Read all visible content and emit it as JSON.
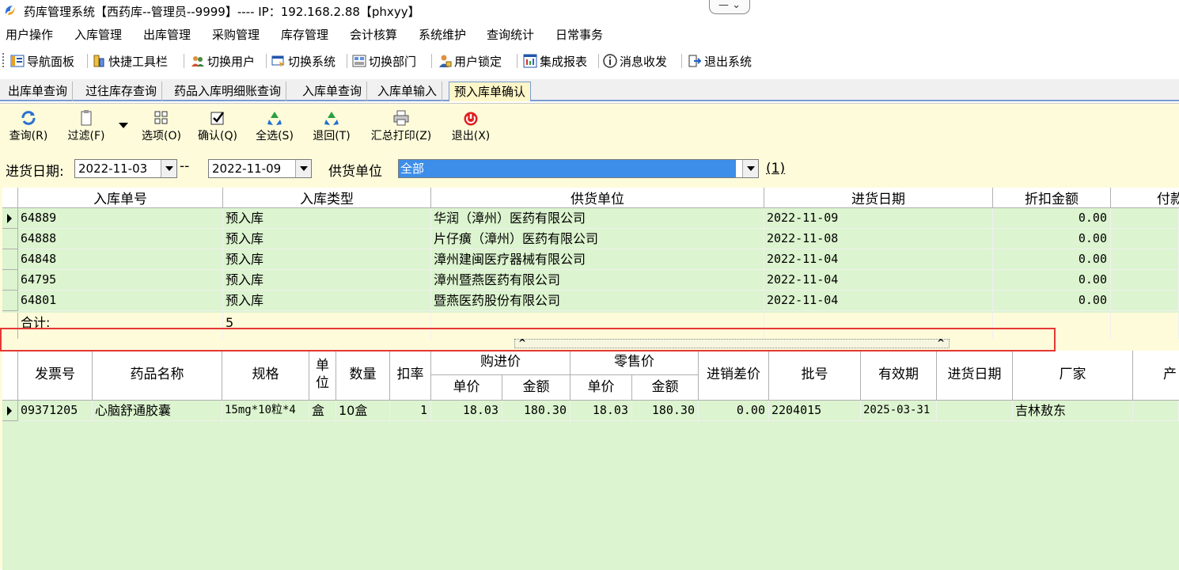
{
  "window": {
    "title": "药库管理系统【西药库--管理员--9999】---- IP：192.168.2.88【phxyy】",
    "controls": "—  ⌄"
  },
  "menu": [
    "用户操作",
    "入库管理",
    "出库管理",
    "采购管理",
    "库存管理",
    "会计核算",
    "系统维护",
    "查询统计",
    "日常事务"
  ],
  "toolbar": [
    "导航面板",
    "快捷工具栏",
    "切换用户",
    "切换系统",
    "切换部门",
    "用户锁定",
    "集成报表",
    "消息收发",
    "退出系统"
  ],
  "tabs": [
    "出库单查询",
    "过往库存查询",
    "药品入库明细账查询",
    "入库单查询",
    "入库单输入",
    "预入库单确认"
  ],
  "actions": [
    "查询(R)",
    "过滤(F)",
    "选项(O)",
    "确认(Q)",
    "全选(S)",
    "退回(T)",
    "汇总打印(Z)",
    "退出(X)"
  ],
  "filter": {
    "date_label": "进货日期:",
    "date_from": "2022-11-03",
    "date_sep": "--",
    "date_to": "2022-11-09",
    "supplier_label": "供货单位",
    "supplier_value": "全部",
    "count_link": "(1)"
  },
  "master_grid": {
    "columns": [
      "入库单号",
      "入库类型",
      "供货单位",
      "进货日期",
      "折扣金额",
      "付款"
    ],
    "rows": [
      [
        "64889",
        "预入库",
        "华润（漳州）医药有限公司",
        "2022-11-09",
        "0.00"
      ],
      [
        "64888",
        "预入库",
        "片仔癀（漳州）医药有限公司",
        "2022-11-08",
        "0.00"
      ],
      [
        "64848",
        "预入库",
        "漳州建闽医疗器械有限公司",
        "2022-11-04",
        "0.00"
      ],
      [
        "64795",
        "预入库",
        "漳州暨燕医药有限公司",
        "2022-11-04",
        "0.00"
      ],
      [
        "64801",
        "预入库",
        "暨燕医药股份有限公司",
        "2022-11-04",
        "0.00"
      ]
    ],
    "total_label": "合计:",
    "total_count": "5"
  },
  "detail_grid": {
    "columns": [
      "发票号",
      "药品名称",
      "规格",
      "单位",
      "数量",
      "扣率",
      "购进价",
      "零售价",
      "进销差价",
      "批号",
      "有效期",
      "进货日期",
      "厂家",
      "产"
    ],
    "sub_columns": [
      "单价",
      "金额",
      "单价",
      "金额"
    ],
    "rows": [
      [
        "09371205",
        "心脑舒通胶囊",
        "15mg*10粒*4",
        "盒",
        "10盒",
        "1",
        "18.03",
        "180.30",
        "18.03",
        "180.30",
        "0.00",
        "2204015",
        "2025-03-31",
        "",
        "吉林敖东"
      ]
    ]
  },
  "colors": {
    "grid_bg": "#dcf4cf",
    "panel_bg": "#fdfbda",
    "highlight": "#e53935",
    "selection": "#3d8ee8"
  }
}
